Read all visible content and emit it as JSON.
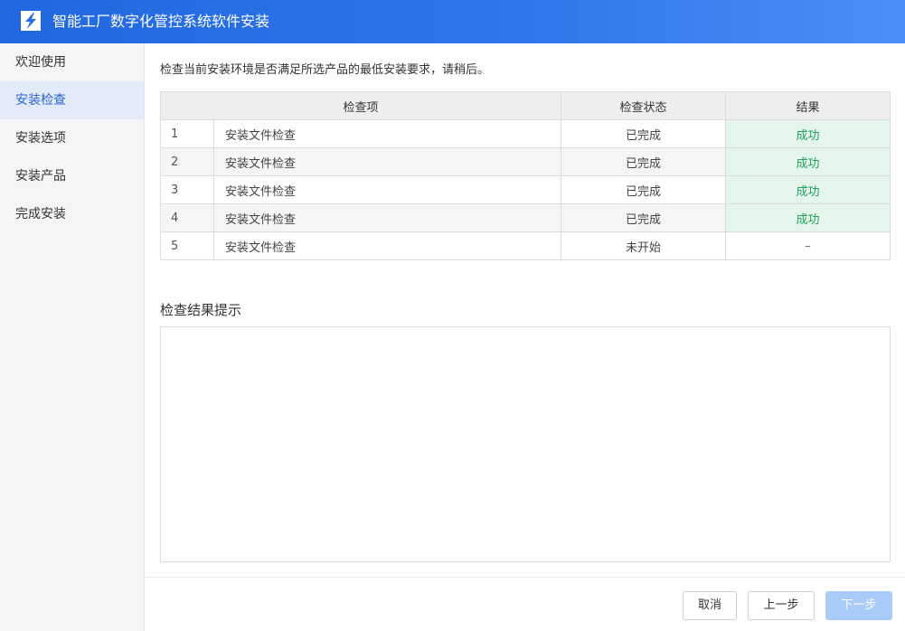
{
  "window": {
    "title": "智能工厂数字化管控系统软件安装"
  },
  "sidebar": {
    "items": [
      {
        "label": "欢迎使用",
        "active": false
      },
      {
        "label": "安装检查",
        "active": true
      },
      {
        "label": "安装选项",
        "active": false
      },
      {
        "label": "安装产品",
        "active": false
      },
      {
        "label": "完成安装",
        "active": false
      }
    ]
  },
  "main": {
    "intro": "检查当前安装环境是否满足所选产品的最低安装要求，请稍后。",
    "table": {
      "headers": [
        "检查项",
        "检查状态",
        "结果"
      ],
      "rows": [
        {
          "num": "1",
          "name": "安装文件检查",
          "status": "已完成",
          "result": "成功"
        },
        {
          "num": "2",
          "name": "安装文件检查",
          "status": "已完成",
          "result": "成功"
        },
        {
          "num": "3",
          "name": "安装文件检查",
          "status": "已完成",
          "result": "成功"
        },
        {
          "num": "4",
          "name": "安装文件检查",
          "status": "已完成",
          "result": "成功"
        },
        {
          "num": "5",
          "name": "安装文件检查",
          "status": "未开始",
          "result": "–"
        }
      ]
    },
    "result_section_title": "检查结果提示",
    "result_text": ""
  },
  "footer": {
    "cancel_label": "取消",
    "prev_label": "上一步",
    "next_label": "下一步",
    "next_enabled": false
  },
  "colors": {
    "title_bar": "#2a6de4",
    "active_nav": "#2a64d3",
    "success_text": "#22a05a",
    "success_bg": "#e4f5ec",
    "next_disabled_bg": "#a9cbf7"
  }
}
